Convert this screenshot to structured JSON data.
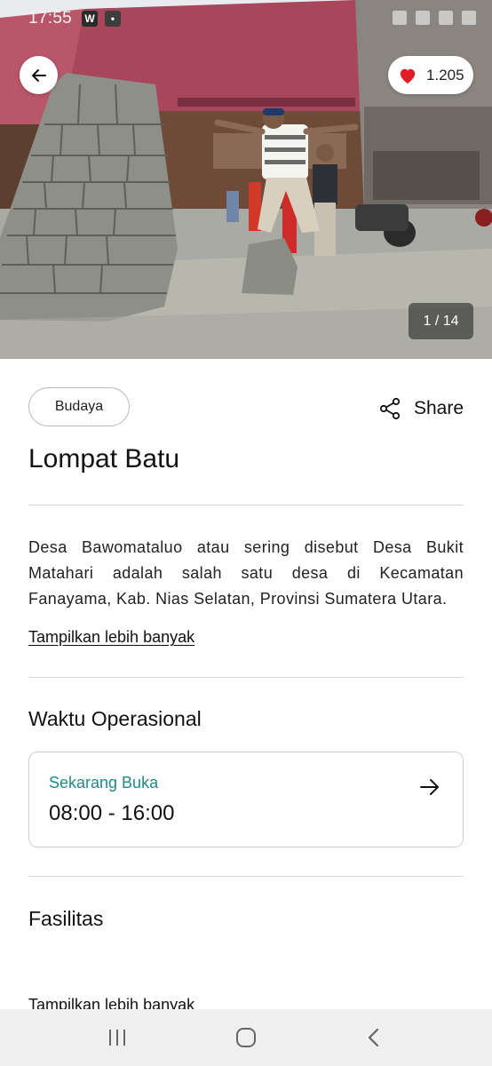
{
  "status_bar": {
    "time": "17:55"
  },
  "hero": {
    "like_count": "1.205",
    "image_counter": "1 / 14"
  },
  "detail": {
    "category": "Budaya",
    "share_label": "Share",
    "title": "Lompat Batu",
    "description": "Desa Bawomataluo atau sering disebut Desa Bukit Matahari adalah salah satu desa di Kecamatan Fanayama, Kab. Nias Selatan, Provinsi Sumatera Utara.",
    "show_more_label": "Tampilkan lebih banyak"
  },
  "hours": {
    "section_title": "Waktu Operasional",
    "status": "Sekarang Buka",
    "range": "08:00 - 16:00"
  },
  "facilities": {
    "section_title": "Fasilitas",
    "show_more_label": "Tampilkan lebih banyak"
  },
  "icons": {
    "back": "arrow-left-icon",
    "like": "heart-icon",
    "share": "share-icon",
    "hours_arrow": "arrow-right-icon",
    "nav_recents": "recents-icon",
    "nav_home": "home-icon",
    "nav_back": "chevron-left-icon"
  },
  "colors": {
    "accent_teal": "#1f8a84",
    "heart_red": "#e11d2a"
  }
}
